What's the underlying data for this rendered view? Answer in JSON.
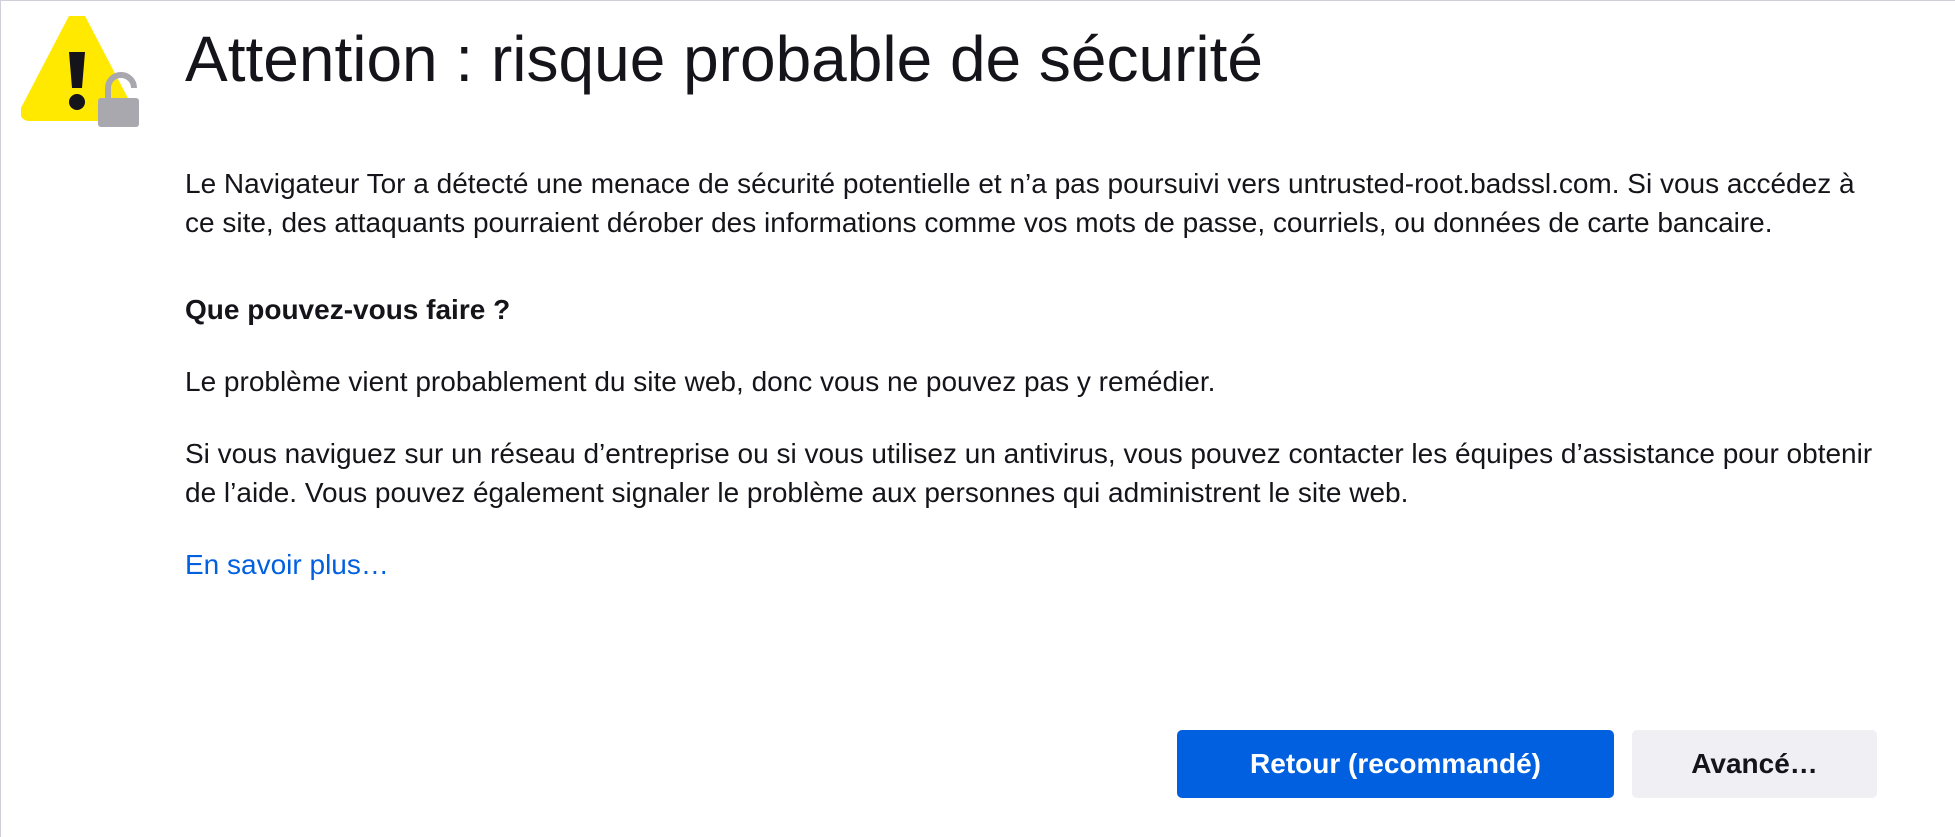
{
  "page": {
    "title": "Attention : risque probable de sécurité",
    "intro": "Le Navigateur Tor a détecté une menace de sécurité potentielle et n’a pas poursuivi vers untrusted-root.badssl.com. Si vous accédez à ce site, des attaquants pourraient dérober des informations comme vos mots de passe, courriels, ou données de carte bancaire.",
    "subheading": "Que pouvez-vous faire ?",
    "paragraph_1": "Le problème vient probablement du site web, donc vous ne pouvez pas y remédier.",
    "paragraph_2": "Si vous naviguez sur un réseau d’entreprise ou si vous utilisez un antivirus, vous pouvez contacter les équipes d’assistance pour obtenir de l’aide. Vous pouvez également signaler le problème aux personnes qui administrent le site web.",
    "learn_more": "En savoir plus…"
  },
  "buttons": {
    "back_label": "Retour (recommandé)",
    "advanced_label": "Avancé…"
  },
  "icons": {
    "warning": "warning-triangle-icon",
    "lock": "broken-lock-icon"
  },
  "colors": {
    "accent": "#0060df",
    "warning": "#ffe900",
    "lock": "#a8a8ae"
  }
}
